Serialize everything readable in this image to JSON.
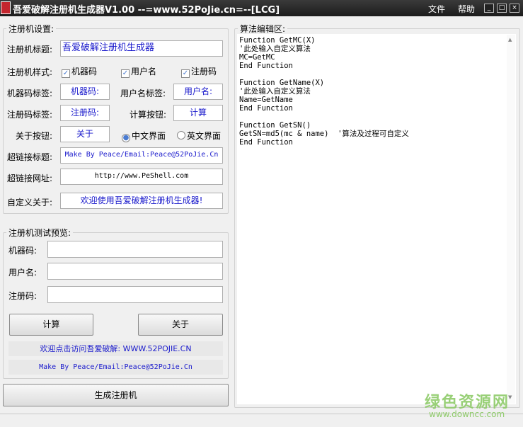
{
  "window": {
    "title": "吾爱破解注册机生成器V1.00  --=www.52PoJie.cn=--[LCG]",
    "icon_text": "吾爱破解",
    "menu": [
      "文件",
      "帮助"
    ],
    "controls": [
      "_",
      "□",
      "×"
    ]
  },
  "settings": {
    "legend": "注册机设置:",
    "title_label": "注册机标题:",
    "title_value": "吾爱破解注册机生成器",
    "style_label": "注册机样式:",
    "styles": [
      {
        "label": "机器码",
        "checked": true
      },
      {
        "label": "用户名",
        "checked": true
      },
      {
        "label": "注册码",
        "checked": true
      }
    ],
    "mc_label": "机器码标签:",
    "mc_value": "机器码:",
    "name_label": "用户名标签:",
    "name_value": "用户名:",
    "sn_label": "注册码标签:",
    "sn_value": "注册码:",
    "calc_label": "计算按钮:",
    "calc_value": "计算",
    "about_label": "关于按钮:",
    "about_value": "关于",
    "ui_options": [
      {
        "label": "中文界面",
        "selected": true
      },
      {
        "label": "英文界面",
        "selected": false
      }
    ],
    "link_title_label": "超链接标题:",
    "link_title_value": "Make By Peace/Email:Peace@52PoJie.Cn",
    "link_url_label": "超链接网址:",
    "link_url_value": "http://www.PeShell.com",
    "about_custom_label": "自定义关于:",
    "about_custom_value": "欢迎使用吾爱破解注册机生成器!"
  },
  "preview": {
    "legend": "注册机测试预览:",
    "mc_label": "机器码:",
    "mc_value": "",
    "name_label": "用户名:",
    "name_value": "",
    "sn_label": "注册码:",
    "sn_value": "",
    "calc_button": "计算",
    "about_button": "关于",
    "link_text": "欢迎点击访问吾爱破解: WWW.52POJIE.CN",
    "credit": "Make By Peace/Email:Peace@52PoJie.Cn"
  },
  "generate_button": "生成注册机",
  "editor": {
    "legend": "算法编辑区:",
    "code": "Function GetMC(X)\n'此处输入自定义算法\nMC=GetMC\nEnd Function\n\nFunction GetName(X)\n'此处输入自定义算法\nName=GetName\nEnd Function\n\nFunction GetSN()\nGetSN=md5(mc & name)  '算法及过程可自定义\nEnd Function"
  },
  "watermark": {
    "name": "绿色资源网",
    "url": "www.downcc.com"
  }
}
